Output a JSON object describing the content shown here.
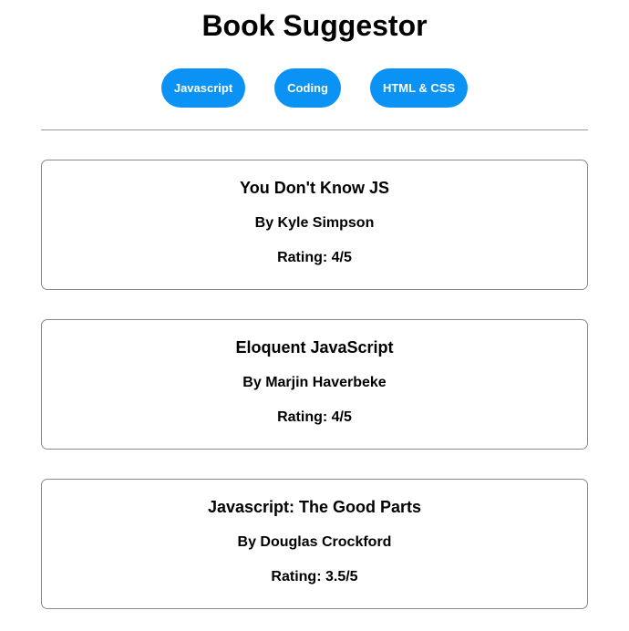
{
  "header": {
    "title": "Book Suggestor"
  },
  "filters": {
    "javascript_label": "Javascript",
    "coding_label": "Coding",
    "html_css_label": "HTML & CSS",
    "button_color": "#0a93f5"
  },
  "books": [
    {
      "title": "You Don't Know JS",
      "author": "By Kyle Simpson",
      "rating": "Rating: 4/5"
    },
    {
      "title": "Eloquent JavaScript",
      "author": "By Marjin Haverbeke",
      "rating": "Rating: 4/5"
    },
    {
      "title": "Javascript: The Good Parts",
      "author": "By Douglas Crockford",
      "rating": "Rating: 3.5/5"
    }
  ]
}
